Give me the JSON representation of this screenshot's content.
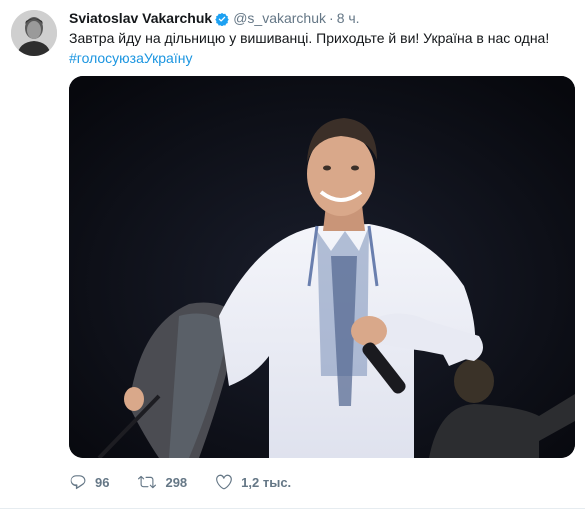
{
  "tweet": {
    "author_name": "Sviatoslav Vakarchuk",
    "handle": "@s_vakarchuk",
    "separator": "·",
    "time": "8 ч.",
    "text": "Завтра йду на дільницю у вишиванці. Приходьте й ви! Україна в нас одна!",
    "hashtag": "#голосуюзаУкраїну"
  },
  "actions": {
    "reply_count": "96",
    "retweet_count": "298",
    "like_count": "1,2 тыс."
  },
  "icons": {
    "verified": "verified-badge-icon",
    "reply": "reply-icon",
    "retweet": "retweet-icon",
    "like": "heart-icon"
  },
  "colors": {
    "link": "#1b95e0",
    "muted": "#657786",
    "text": "#14171a"
  }
}
